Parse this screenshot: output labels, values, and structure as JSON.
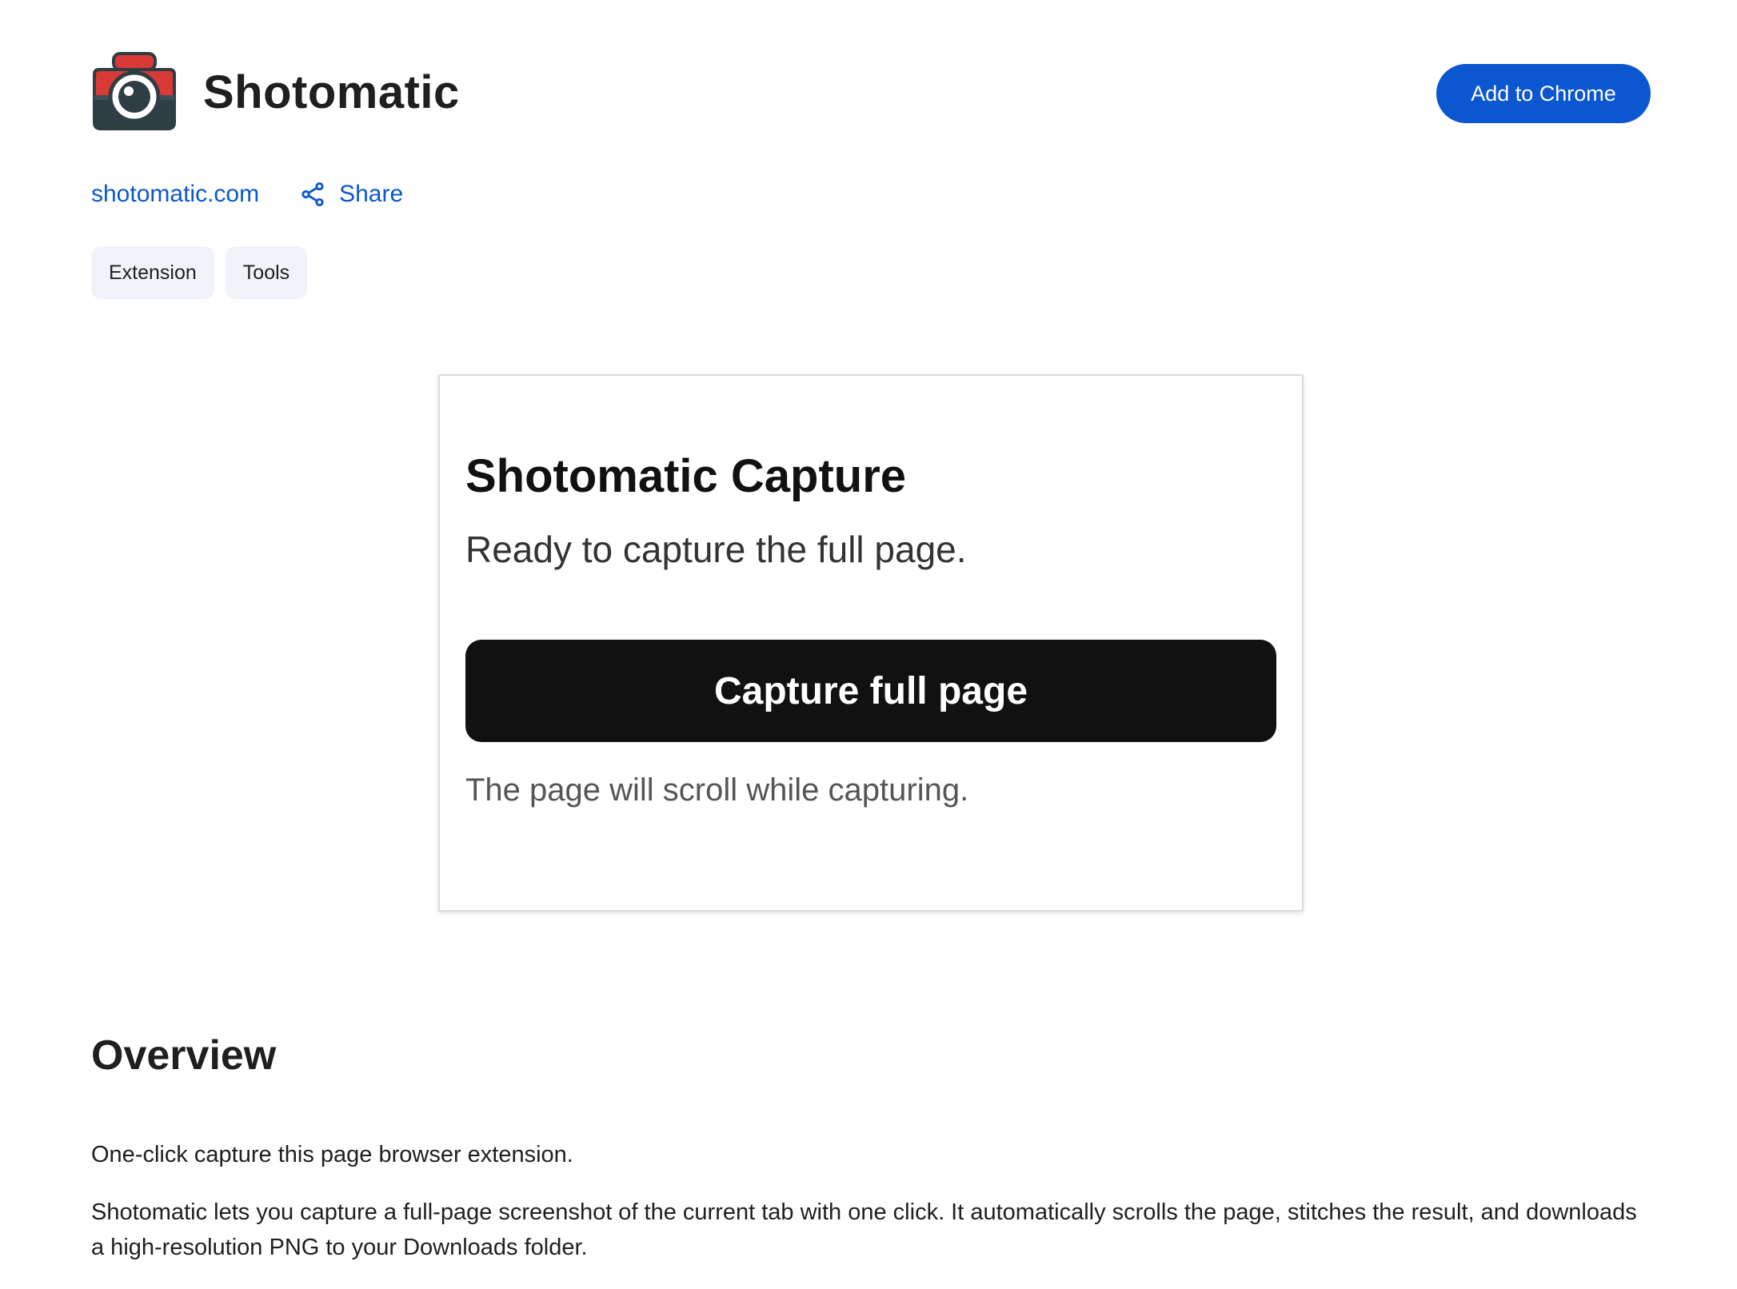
{
  "header": {
    "app_name": "Shotomatic",
    "add_button_label": "Add to Chrome"
  },
  "links": {
    "website": "shotomatic.com",
    "share_label": "Share"
  },
  "chips": [
    "Extension",
    "Tools"
  ],
  "preview": {
    "title": "Shotomatic Capture",
    "status": "Ready to capture the full page.",
    "button_label": "Capture full page",
    "note": "The page will scroll while capturing."
  },
  "overview": {
    "heading": "Overview",
    "summary": "One-click capture this page browser extension.",
    "description": "Shotomatic lets you capture a full-page screenshot of the current tab with one click. It automatically scrolls the page, stitches the result, and downloads a high-resolution PNG to your Downloads folder."
  },
  "colors": {
    "accent": "#0b57d0",
    "chip_background": "#f0f4f9",
    "icon_red": "#d93a35",
    "icon_dark": "#2f3d45"
  },
  "icons": {
    "app": "camera-icon",
    "share": "share-icon"
  }
}
